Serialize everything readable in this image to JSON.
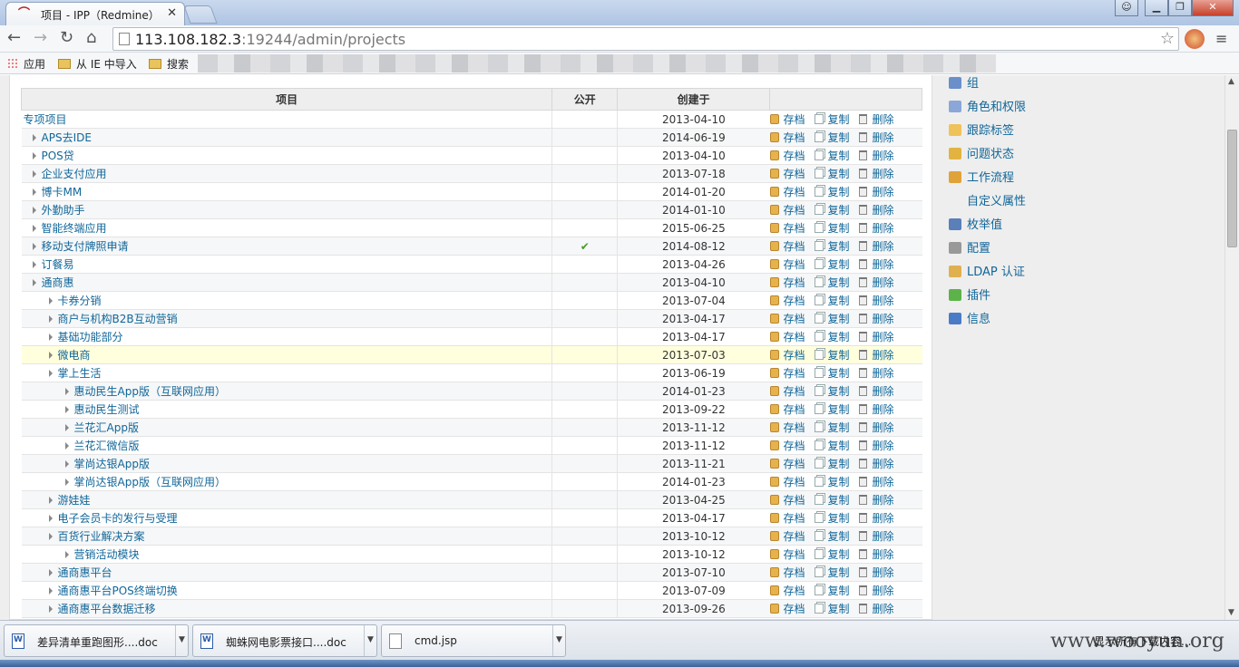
{
  "browser": {
    "tab_title": "项目 - IPP（Redmine）",
    "url_host": "113.108.182.3",
    "url_rest": ":19244/admin/projects",
    "bookmarks": [
      "应用",
      "从 IE 中导入",
      "搜索"
    ]
  },
  "table": {
    "headers": {
      "name": "项目",
      "public": "公开",
      "created": "创建于"
    },
    "actions": {
      "archive": "存档",
      "copy": "复制",
      "delete": "删除"
    },
    "rows": [
      {
        "name": "专项项目",
        "level": 0,
        "public": "",
        "date": "2013-04-10"
      },
      {
        "name": "APS去IDE",
        "level": 1,
        "public": "",
        "date": "2014-06-19"
      },
      {
        "name": "POS贷",
        "level": 1,
        "public": "",
        "date": "2013-04-10"
      },
      {
        "name": "企业支付应用",
        "level": 1,
        "public": "",
        "date": "2013-07-18"
      },
      {
        "name": "博卡MM",
        "level": 1,
        "public": "",
        "date": "2014-01-20"
      },
      {
        "name": "外勤助手",
        "level": 1,
        "public": "",
        "date": "2014-01-10"
      },
      {
        "name": "智能终端应用",
        "level": 1,
        "public": "",
        "date": "2015-06-25"
      },
      {
        "name": "移动支付牌照申请",
        "level": 1,
        "public": "✔",
        "date": "2014-08-12"
      },
      {
        "name": "订餐易",
        "level": 1,
        "public": "",
        "date": "2013-04-26"
      },
      {
        "name": "通商惠",
        "level": 1,
        "public": "",
        "date": "2013-04-10"
      },
      {
        "name": "卡券分销",
        "level": 2,
        "public": "",
        "date": "2013-07-04"
      },
      {
        "name": "商户与机构B2B互动营销",
        "level": 2,
        "public": "",
        "date": "2013-04-17"
      },
      {
        "name": "基础功能部分",
        "level": 2,
        "public": "",
        "date": "2013-04-17"
      },
      {
        "name": "微电商",
        "level": 2,
        "public": "",
        "date": "2013-07-03",
        "highlight": true
      },
      {
        "name": "掌上生活",
        "level": 2,
        "public": "",
        "date": "2013-06-19"
      },
      {
        "name": "惠动民生App版（互联网应用）",
        "level": 3,
        "public": "",
        "date": "2014-01-23"
      },
      {
        "name": "惠动民生测试",
        "level": 3,
        "public": "",
        "date": "2013-09-22"
      },
      {
        "name": "兰花汇App版",
        "level": 3,
        "public": "",
        "date": "2013-11-12"
      },
      {
        "name": "兰花汇微信版",
        "level": 3,
        "public": "",
        "date": "2013-11-12"
      },
      {
        "name": "掌尚达银App版",
        "level": 3,
        "public": "",
        "date": "2013-11-21"
      },
      {
        "name": "掌尚达银App版（互联网应用）",
        "level": 3,
        "public": "",
        "date": "2014-01-23"
      },
      {
        "name": "游娃娃",
        "level": 2,
        "public": "",
        "date": "2013-04-25"
      },
      {
        "name": "电子会员卡的发行与受理",
        "level": 2,
        "public": "",
        "date": "2013-04-17"
      },
      {
        "name": "百货行业解决方案",
        "level": 2,
        "public": "",
        "date": "2013-10-12"
      },
      {
        "name": "营销活动模块",
        "level": 3,
        "public": "",
        "date": "2013-10-12"
      },
      {
        "name": "通商惠平台",
        "level": 2,
        "public": "",
        "date": "2013-07-10"
      },
      {
        "name": "通商惠平台POS终端切换",
        "level": 2,
        "public": "",
        "date": "2013-07-09"
      },
      {
        "name": "通商惠平台数据迁移",
        "level": 2,
        "public": "",
        "date": "2013-09-26"
      }
    ]
  },
  "sidebar": {
    "items": [
      {
        "label": "组",
        "icon": "group-icon",
        "color": "#6a8fc9"
      },
      {
        "label": "角色和权限",
        "icon": "key-icon",
        "color": "#8aa7d8"
      },
      {
        "label": "跟踪标签",
        "icon": "tag-icon",
        "color": "#efc35a"
      },
      {
        "label": "问题状态",
        "icon": "status-icon",
        "color": "#e3b342"
      },
      {
        "label": "工作流程",
        "icon": "workflow-icon",
        "color": "#e0a33a"
      },
      {
        "label": "自定义属性",
        "icon": "custom-field-icon",
        "color": "#eeeeee"
      },
      {
        "label": "枚举值",
        "icon": "list-icon",
        "color": "#5b7fb8"
      },
      {
        "label": "配置",
        "icon": "gear-icon",
        "color": "#999999"
      },
      {
        "label": "LDAP 认证",
        "icon": "ldap-icon",
        "color": "#e0b050"
      },
      {
        "label": "插件",
        "icon": "plugin-icon",
        "color": "#5cb34a"
      },
      {
        "label": "信息",
        "icon": "info-icon",
        "color": "#4a7bc7"
      }
    ]
  },
  "downloads": {
    "items": [
      "差异清单重跑图形....doc",
      "蜘蛛网电影票接口....doc",
      "cmd.jsp"
    ],
    "show_all": "显示所有下载内容..."
  },
  "watermark": "www.wooyun.org"
}
